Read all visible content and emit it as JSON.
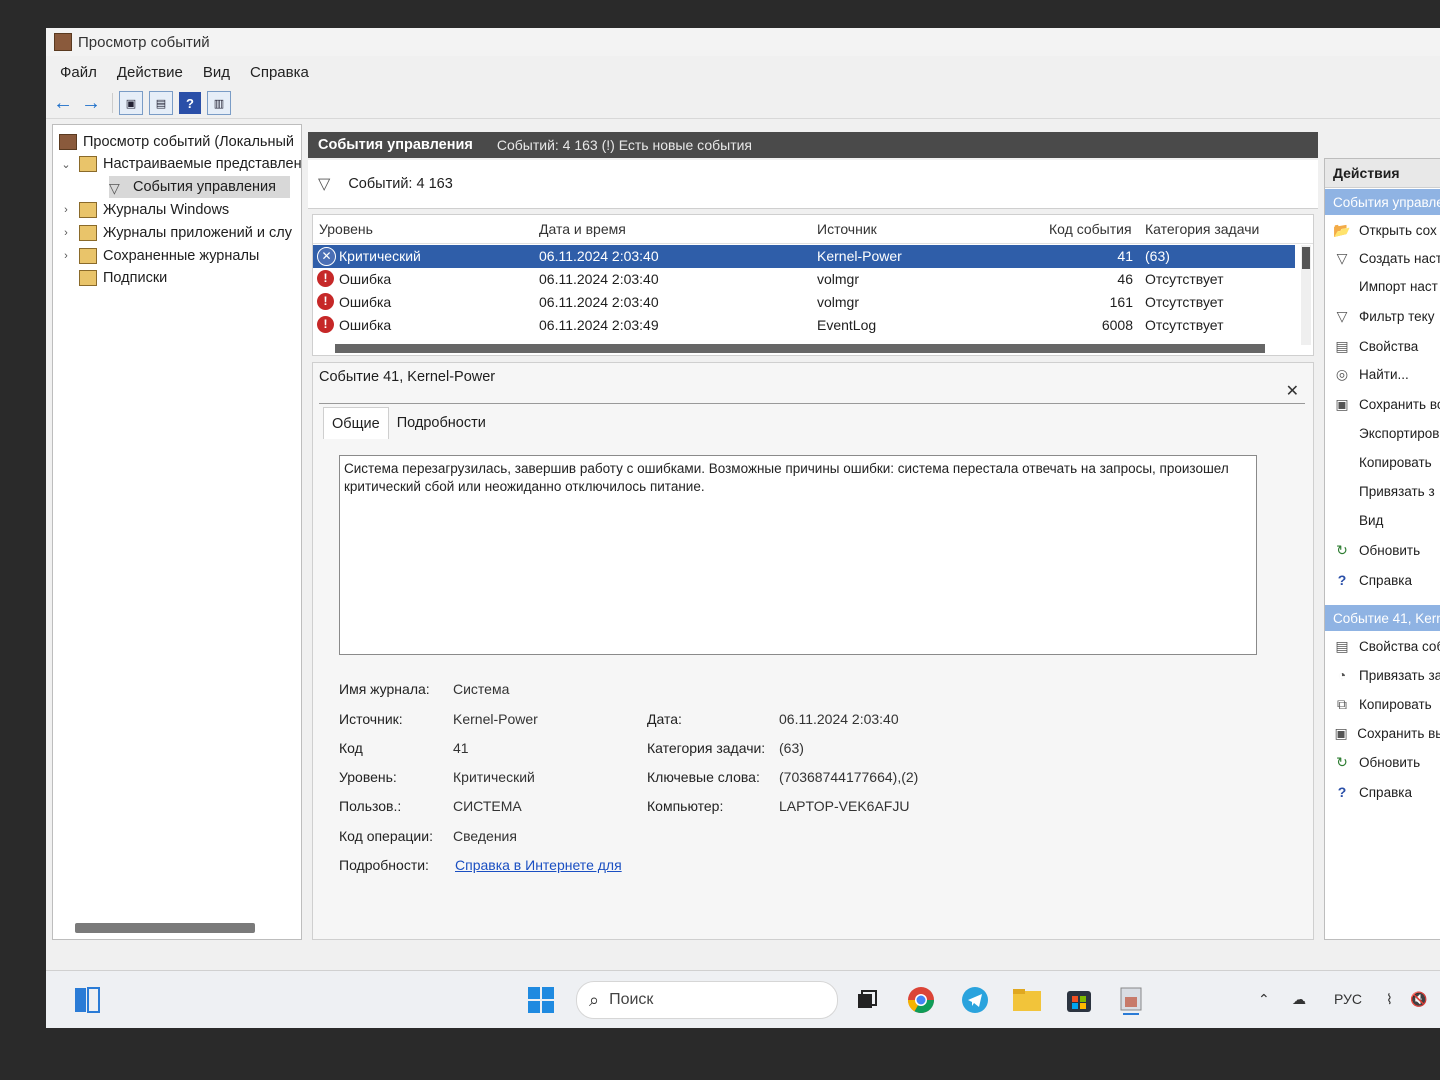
{
  "window": {
    "title": "Просмотр событий"
  },
  "menu": [
    "Файл",
    "Действие",
    "Вид",
    "Справка"
  ],
  "tree": {
    "root": "Просмотр событий (Локальный",
    "custom_views": "Настраиваемые представлен",
    "admin_events": "События управления",
    "windows_logs": "Журналы Windows",
    "app_logs": "Журналы приложений и слу",
    "saved_logs": "Сохраненные журналы",
    "subscriptions": "Подписки"
  },
  "center": {
    "header_title": "События управления",
    "header_info": "Событий: 4 163 (!) Есть новые события",
    "count_label": "Событий: 4 163"
  },
  "grid": {
    "columns": [
      "Уровень",
      "Дата и время",
      "Источник",
      "Код события",
      "Категория задачи"
    ],
    "rows": [
      {
        "level": "Критический",
        "datetime": "06.11.2024 2:03:40",
        "source": "Kernel-Power",
        "code": "41",
        "category": "(63)"
      },
      {
        "level": "Ошибка",
        "datetime": "06.11.2024 2:03:40",
        "source": "volmgr",
        "code": "46",
        "category": "Отсутствует"
      },
      {
        "level": "Ошибка",
        "datetime": "06.11.2024 2:03:40",
        "source": "volmgr",
        "code": "161",
        "category": "Отсутствует"
      },
      {
        "level": "Ошибка",
        "datetime": "06.11.2024 2:03:49",
        "source": "EventLog",
        "code": "6008",
        "category": "Отсутствует"
      }
    ]
  },
  "detail": {
    "title": "Событие 41, Kernel-Power",
    "tabs": [
      "Общие",
      "Подробности"
    ],
    "description": "Система перезагрузилась, завершив работу с ошибками. Возможные причины ошибки: система перестала отвечать на запросы, произошел критический сбой или неожиданно отключилось питание.",
    "props": {
      "log_name_label": "Имя журнала:",
      "log_name": "Система",
      "source_label": "Источник:",
      "source": "Kernel-Power",
      "date_label": "Дата:",
      "date": "06.11.2024 2:03:40",
      "code_label": "Код",
      "code": "41",
      "category_label": "Категория задачи:",
      "category": "(63)",
      "level_label": "Уровень:",
      "level": "Критический",
      "keywords_label": "Ключевые слова:",
      "keywords": "(70368744177664),(2)",
      "user_label": "Пользов.:",
      "user": "СИСТЕМА",
      "computer_label": "Компьютер:",
      "computer": "LAPTOP-VEK6AFJU",
      "opcode_label": "Код операции:",
      "opcode": "Сведения",
      "more_label": "Подробности:",
      "more_link": "Справка в Интернете для"
    }
  },
  "actions": {
    "header": "Действия",
    "section1": "События управле",
    "items1": [
      "Открыть сох",
      "Создать наст",
      "Импорт наст",
      "Фильтр теку",
      "Свойства",
      "Найти...",
      "Сохранить вс",
      "Экспортиров",
      "Копировать",
      "Привязать з",
      "Вид",
      "Обновить",
      "Справка"
    ],
    "section2": "Событие 41, Kerne",
    "items2": [
      "Свойства соб",
      "Привязать за",
      "Копировать",
      "Сохранить вы",
      "Обновить",
      "Справка"
    ]
  },
  "taskbar": {
    "search": "Поиск",
    "lang": "РУС"
  }
}
